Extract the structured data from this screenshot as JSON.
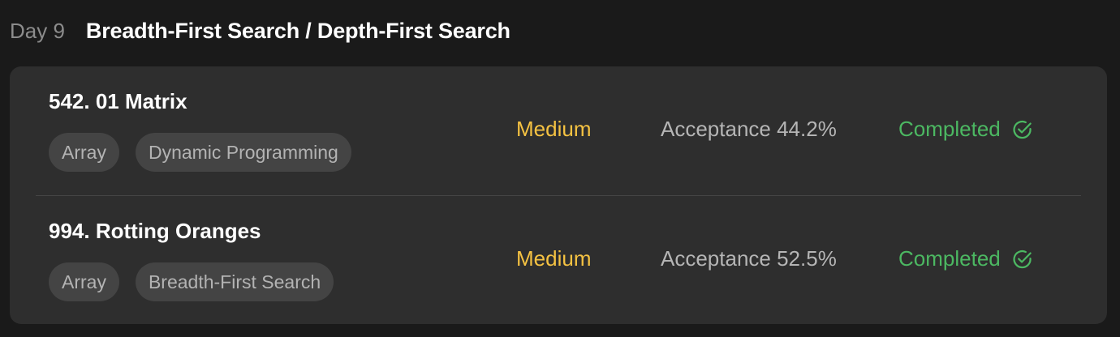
{
  "header": {
    "day_label": "Day 9",
    "title": "Breadth-First Search / Depth-First Search"
  },
  "problems": [
    {
      "title": "542. 01 Matrix",
      "tags": [
        "Array",
        "Dynamic Programming"
      ],
      "difficulty": "Medium",
      "acceptance": "Acceptance 44.2%",
      "status": "Completed",
      "status_icon": "check-circle-icon"
    },
    {
      "title": "994. Rotting Oranges",
      "tags": [
        "Array",
        "Breadth-First Search"
      ],
      "difficulty": "Medium",
      "acceptance": "Acceptance 52.5%",
      "status": "Completed",
      "status_icon": "check-circle-icon"
    }
  ],
  "colors": {
    "background": "#1a1a1a",
    "card": "#2e2e2e",
    "medium": "#f5c242",
    "completed": "#4cb862"
  }
}
